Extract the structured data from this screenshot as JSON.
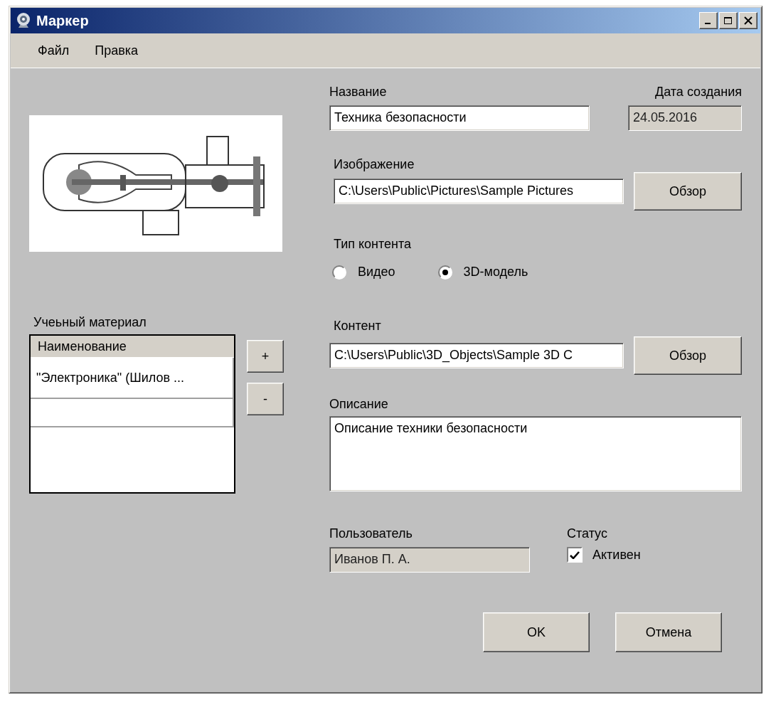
{
  "window": {
    "title": "Маркер"
  },
  "menu": [
    "Файл",
    "Правка"
  ],
  "materials": {
    "label": "Учеьный материал",
    "columns": [
      "Наименование"
    ],
    "rows": [
      {
        "name": "\"Электроника\" (Шилов ..."
      }
    ],
    "buttons": [
      "+",
      "-"
    ]
  },
  "name": {
    "label": "Название",
    "value": "Техника безопасности",
    "disabled": false
  },
  "created": {
    "label": "Дата создания",
    "value": "24.05.2016",
    "disabled": true
  },
  "image": {
    "label": "Изображение",
    "value": "C:\\Users\\Public\\Pictures\\Sample Pictures",
    "disabled": false,
    "button": "Обзор"
  },
  "content_type": {
    "label": "Тип контента",
    "options": [
      {
        "label": "Видео",
        "selected": false
      },
      {
        "label": "3D-модель",
        "selected": true
      }
    ]
  },
  "content": {
    "label": "Контент",
    "value": "C:\\Users\\Public\\3D_Objects\\Sample 3D C",
    "disabled": false,
    "button": "Обзор"
  },
  "description": {
    "label": "Описание",
    "value": "Описание техники безопасности"
  },
  "user": {
    "label": "Пользователь",
    "value": "Иванов П. А.",
    "disabled": true
  },
  "status": {
    "label": "Статус",
    "checkbox": {
      "label": "Активен",
      "checked": true
    }
  },
  "buttons": [
    "OK",
    "Отмена"
  ]
}
